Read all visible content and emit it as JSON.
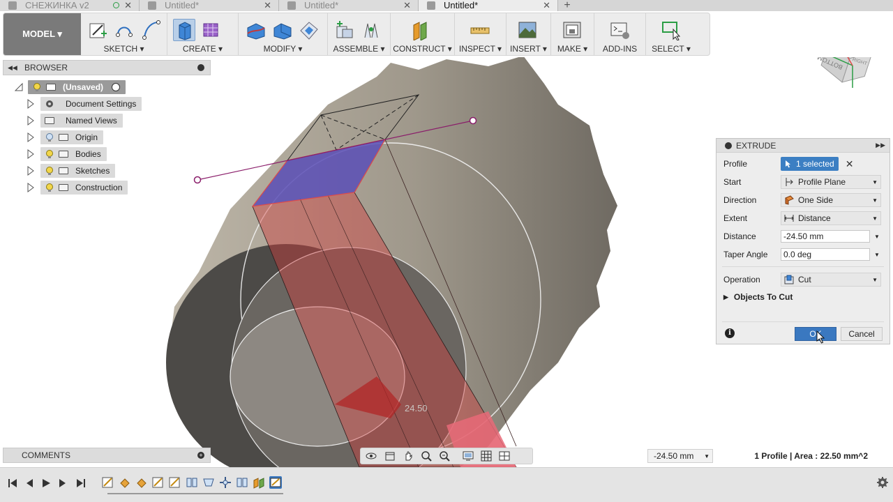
{
  "tabs": [
    {
      "label": "СНЕЖИНКА v2",
      "active": false
    },
    {
      "label": "Untitled*",
      "active": false
    },
    {
      "label": "Untitled*",
      "active": false
    },
    {
      "label": "Untitled*",
      "active": true
    }
  ],
  "toolbar": {
    "workspace": "MODEL ▾",
    "groups": [
      {
        "label": "SKETCH ▾"
      },
      {
        "label": "CREATE ▾"
      },
      {
        "label": "MODIFY ▾"
      },
      {
        "label": "ASSEMBLE ▾"
      },
      {
        "label": "CONSTRUCT ▾"
      },
      {
        "label": "INSPECT ▾"
      },
      {
        "label": "INSERT ▾"
      },
      {
        "label": "MAKE ▾"
      },
      {
        "label": "ADD-INS"
      },
      {
        "label": "SELECT ▾"
      }
    ]
  },
  "browser": {
    "title": "BROWSER",
    "root": "(Unsaved)",
    "items": [
      {
        "label": "Document Settings",
        "icon": "gear-icon"
      },
      {
        "label": "Named Views",
        "icon": "folder-icon"
      },
      {
        "label": "Origin",
        "icon": "bulb-icon"
      },
      {
        "label": "Bodies",
        "icon": "bulb-icon"
      },
      {
        "label": "Sketches",
        "icon": "bulb-icon"
      },
      {
        "label": "Construction",
        "icon": "bulb-icon"
      }
    ]
  },
  "viewcube": {
    "face_front": "BOTTOM",
    "face_side": "RIGHT"
  },
  "viewport": {
    "dimension_label": "24.50"
  },
  "extrude": {
    "title": "EXTRUDE",
    "profile_label": "Profile",
    "profile_value": "1 selected",
    "start_label": "Start",
    "start_value": "Profile Plane",
    "direction_label": "Direction",
    "direction_value": "One Side",
    "extent_label": "Extent",
    "extent_value": "Distance",
    "distance_label": "Distance",
    "distance_value": "-24.50 mm",
    "taper_label": "Taper Angle",
    "taper_value": "0.0 deg",
    "operation_label": "Operation",
    "operation_value": "Cut",
    "objects_label": "Objects To Cut",
    "ok_label": "OK",
    "cancel_label": "Cancel"
  },
  "comments": {
    "title": "COMMENTS"
  },
  "bottom": {
    "distance_field": "-24.50 mm",
    "status": "1 Profile | Area : 22.50 mm^2"
  },
  "colors": {
    "accent": "#3c7fc3",
    "body": "#9b9387",
    "cut_red": "#d23a3a",
    "profile_blue": "#4a52c8"
  }
}
